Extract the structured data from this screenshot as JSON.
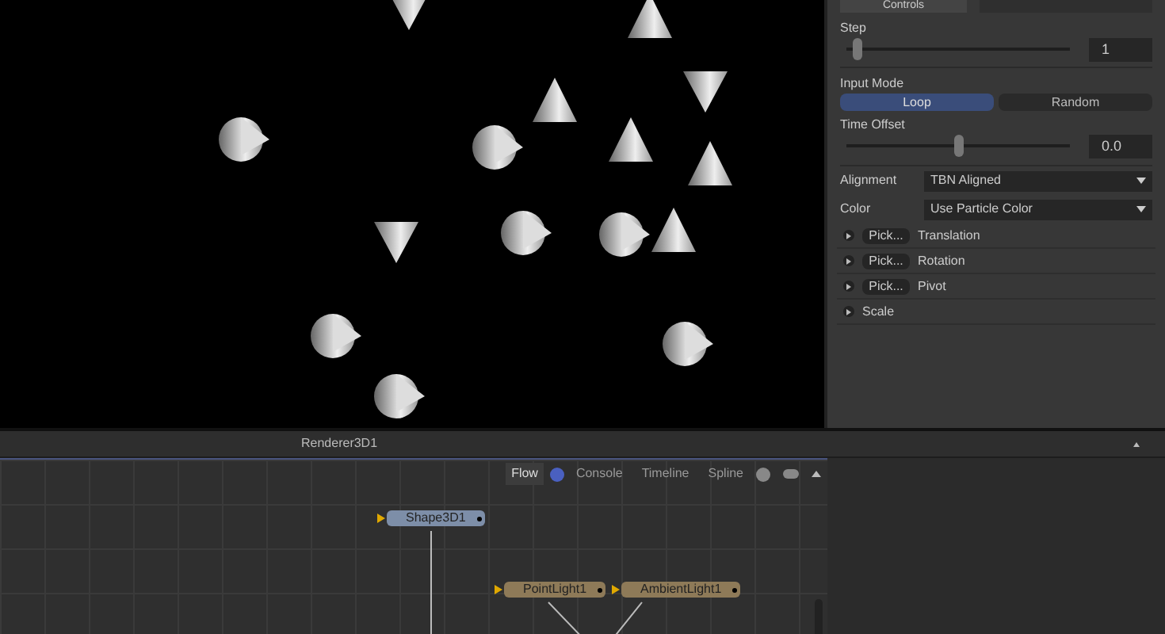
{
  "controls_tab": "Controls",
  "step": {
    "label": "Step",
    "level": 0.05,
    "value": "1"
  },
  "input_mode": {
    "label": "Input Mode",
    "options": [
      {
        "label": "Loop",
        "selected": true
      },
      {
        "label": "Random",
        "selected": false
      }
    ]
  },
  "time_offset": {
    "label": "Time Offset",
    "level": 0.5,
    "value": "0.0"
  },
  "dropdowns": [
    {
      "label": "Alignment",
      "value": "TBN Aligned"
    },
    {
      "label": "Color",
      "value": "Use Particle Color"
    }
  ],
  "transforms": [
    {
      "label": "Translation",
      "button": "Pick..."
    },
    {
      "label": "Rotation",
      "button": "Pick..."
    },
    {
      "label": "Pivot",
      "button": "Pick..."
    },
    {
      "label": "Scale"
    }
  ],
  "viewer_title": "Renderer3D1",
  "flow_tabs": [
    {
      "label": "Flow",
      "selected": true
    },
    {
      "label": "Console",
      "selected": false
    },
    {
      "label": "Timeline",
      "selected": false
    },
    {
      "label": "Spline",
      "selected": false
    }
  ],
  "nodes": [
    {
      "label": "Shape3D1",
      "kind": "shape"
    },
    {
      "label": "PointLight1",
      "kind": "light"
    },
    {
      "label": "AmbientLight1",
      "kind": "light"
    }
  ]
}
